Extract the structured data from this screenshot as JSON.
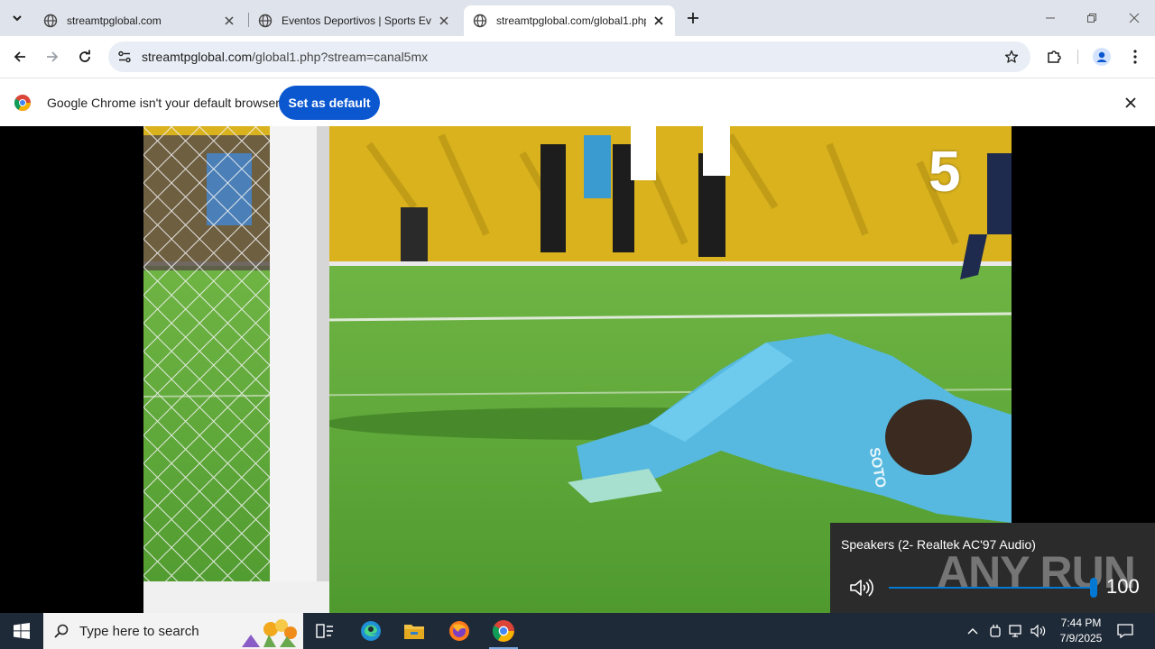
{
  "browser": {
    "tabs": [
      {
        "title": "streamtpglobal.com",
        "active": false
      },
      {
        "title": "Eventos Deportivos | Sports Eve",
        "active": false
      },
      {
        "title": "streamtpglobal.com/global1.php",
        "active": true
      }
    ],
    "address": {
      "host": "streamtpglobal.com",
      "path": "/global1.php?stream=canal5mx"
    },
    "infobar": {
      "message": "Google Chrome isn't your default browser",
      "button": "Set as default"
    }
  },
  "video": {
    "channel_logo": "5",
    "jersey_text": "SOTO"
  },
  "volume_flyout": {
    "device": "Speakers (2- Realtek AC'97 Audio)",
    "level": 100,
    "level_text": "100",
    "watermark": "ANY RUN"
  },
  "taskbar": {
    "search_placeholder": "Type here to search",
    "apps": [
      "task-view-icon",
      "edge-icon",
      "file-explorer-icon",
      "firefox-icon",
      "chrome-icon"
    ],
    "clock_time": "7:44 PM",
    "clock_date": "7/9/2025"
  },
  "colors": {
    "accent_blue": "#0b57d0",
    "tabstrip": "#dfe3eb",
    "taskbar": "#1f2a38",
    "volume_accent": "#0078d4"
  }
}
